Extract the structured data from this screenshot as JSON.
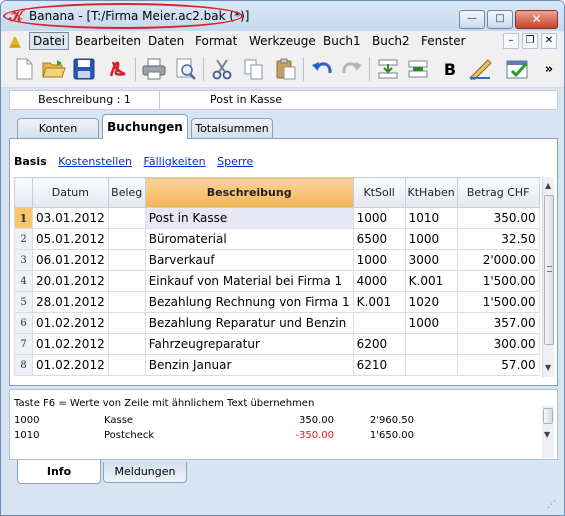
{
  "window": {
    "title": "Banana - [T:/Firma Meier.ac2.bak (*)]",
    "min": "—",
    "max": "□",
    "close": "✕"
  },
  "menu": {
    "items": [
      "Datei",
      "Bearbeiten",
      "Daten",
      "Format",
      "Werkzeuge",
      "Buch1",
      "Buch2",
      "Fenster"
    ],
    "more": "»"
  },
  "cell": {
    "ref": "Beschreibung : 1",
    "value": "Post in Kasse"
  },
  "tabs": [
    "Konten",
    "Buchungen",
    "Totalsummen"
  ],
  "views": [
    "Basis",
    "Kostenstellen",
    "Fälligkeiten",
    "Sperre"
  ],
  "table": {
    "columns": [
      "Datum",
      "Beleg",
      "Beschreibung",
      "KtSoll",
      "KtHaben",
      "Betrag CHF"
    ],
    "rows": [
      [
        "1",
        "03.01.2012",
        "",
        "Post in Kasse",
        "1000",
        "1010",
        "350.00"
      ],
      [
        "2",
        "05.01.2012",
        "",
        "Büromaterial",
        "6500",
        "1000",
        "32.50"
      ],
      [
        "3",
        "06.01.2012",
        "",
        "Barverkauf",
        "1000",
        "3000",
        "2'000.00"
      ],
      [
        "4",
        "20.01.2012",
        "",
        "Einkauf von Material bei Firma 1",
        "4000",
        "K.001",
        "1'500.00"
      ],
      [
        "5",
        "28.01.2012",
        "",
        "Bezahlung Rechnung von Firma 1",
        "K.001",
        "1020",
        "1'500.00"
      ],
      [
        "6",
        "01.02.2012",
        "",
        "Bezahlung Reparatur und Benzin",
        "",
        "1000",
        "357.00"
      ],
      [
        "7",
        "01.02.2012",
        "",
        "Fahrzeugreparatur",
        "6200",
        "",
        "300.00"
      ],
      [
        "8",
        "01.02.2012",
        "",
        "Benzin Januar",
        "6210",
        "",
        "57.00"
      ]
    ]
  },
  "info": {
    "header": "Taste F6 = Werte von Zeile mit ähnlichem Text übernehmen",
    "rows": [
      {
        "account": "1000",
        "name": "Kasse",
        "amount": "350.00",
        "balance": "2'960.50",
        "negative": false
      },
      {
        "account": "1010",
        "name": "Postcheck",
        "amount": "-350.00",
        "balance": "1'650.00",
        "negative": true
      }
    ]
  },
  "bottom_tabs": [
    "Info",
    "Meldungen"
  ],
  "colors": {
    "title_highlight": "#d8232a",
    "selected_header": "#f5b45a",
    "negative": "#e02020",
    "link": "#0033cc"
  }
}
